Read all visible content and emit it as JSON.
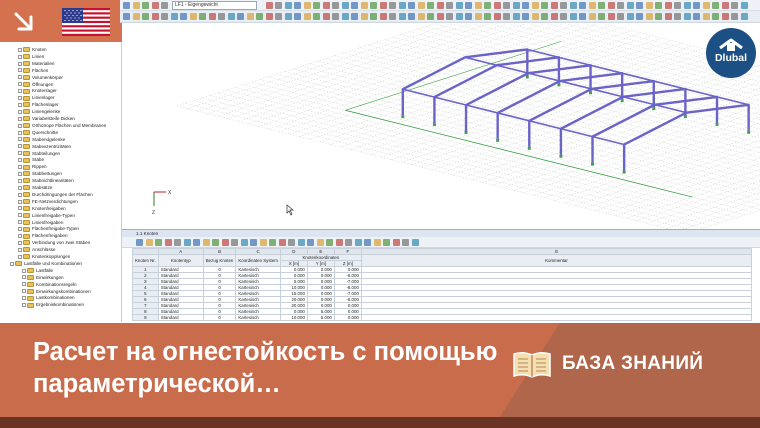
{
  "toolbar": {
    "loadcase": "LF1 - Eigengewicht"
  },
  "navigator": {
    "items": [
      "Knoten",
      "Linien",
      "Materialien",
      "Flächen",
      "Volumenkörper",
      "Öffnungen",
      "Knotenlager",
      "Linienlager",
      "Flächenlager",
      "Liniengelenke",
      "Variabelsteife Dicken",
      "Orthotrope Flächen und Membranen",
      "Querschnitte",
      "Stabendgelenke",
      "Stabexzentrizitäten",
      "Stabteilungen",
      "Stäbe",
      "Rippen",
      "Stabbettungen",
      "Stabnichtlinearitäten",
      "Stabsätze",
      "Durchdringungen der Flächen",
      "FE-Netzverdichtungen",
      "Knotenfreigaben",
      "Linienfreigabe-Typen",
      "Linienfreigaben",
      "Flächenfreigabe-Typen",
      "Flächenfreigaben",
      "Verbindung von zwei Stäben",
      "Anschlüsse",
      "Knotenkopplungen",
      "Lastfälle und Kombinationen",
      "Lastfälle",
      "Einwirkungen",
      "Kombinationsregeln",
      "Einwirkungskombinationen",
      "Lastkombinationen",
      "Ergebniskombinationen"
    ]
  },
  "axes": {
    "x": "X",
    "z": "Z"
  },
  "table": {
    "title": "1.1 Knoten",
    "col_letters": [
      "A",
      "B",
      "C",
      "D",
      "E",
      "F",
      "G"
    ],
    "headers": {
      "node_no": "Knoten Nr.",
      "node_type": "Knotentyp",
      "ref_node": "Bezug Knoten",
      "coord_system": "Koordinaten System",
      "coords_group": "Knotenkoordinaten",
      "x": "X [m]",
      "y": "Y [m]",
      "z": "Z [m]",
      "comment": "Kommentar"
    },
    "rows": [
      {
        "no": "1",
        "type": "Standard",
        "ref": "0",
        "sys": "Kartesisch",
        "x": "0.000",
        "y": "0.000",
        "z": "0.000"
      },
      {
        "no": "2",
        "type": "Standard",
        "ref": "0",
        "sys": "Kartesisch",
        "x": "0.000",
        "y": "0.000",
        "z": "-6.000"
      },
      {
        "no": "3",
        "type": "Standard",
        "ref": "0",
        "sys": "Kartesisch",
        "x": "5.000",
        "y": "0.000",
        "z": "-7.000"
      },
      {
        "no": "4",
        "type": "Standard",
        "ref": "0",
        "sys": "Kartesisch",
        "x": "10.000",
        "y": "0.000",
        "z": "-8.000"
      },
      {
        "no": "5",
        "type": "Standard",
        "ref": "0",
        "sys": "Kartesisch",
        "x": "15.000",
        "y": "0.000",
        "z": "-7.000"
      },
      {
        "no": "6",
        "type": "Standard",
        "ref": "0",
        "sys": "Kartesisch",
        "x": "20.000",
        "y": "0.000",
        "z": "-6.000"
      },
      {
        "no": "7",
        "type": "Standard",
        "ref": "0",
        "sys": "Kartesisch",
        "x": "20.000",
        "y": "0.000",
        "z": "0.000"
      },
      {
        "no": "8",
        "type": "Standard",
        "ref": "0",
        "sys": "Kartesisch",
        "x": "0.000",
        "y": "5.000",
        "z": "0.000"
      },
      {
        "no": "9",
        "type": "Standard",
        "ref": "0",
        "sys": "Kartesisch",
        "x": "10.000",
        "y": "5.000",
        "z": "0.000"
      }
    ]
  },
  "brand": {
    "logo_text": "Dlubal"
  },
  "banner": {
    "title": "Расчет на огнестойкость с помощью параметрической…",
    "knowledge_base": "БАЗА ЗНАНИЙ"
  },
  "colors": {
    "accent": "#d4714e",
    "banner_dark": "#8f4a32",
    "frame": "#6b63c8",
    "dlubal_blue": "#1c4f84"
  }
}
